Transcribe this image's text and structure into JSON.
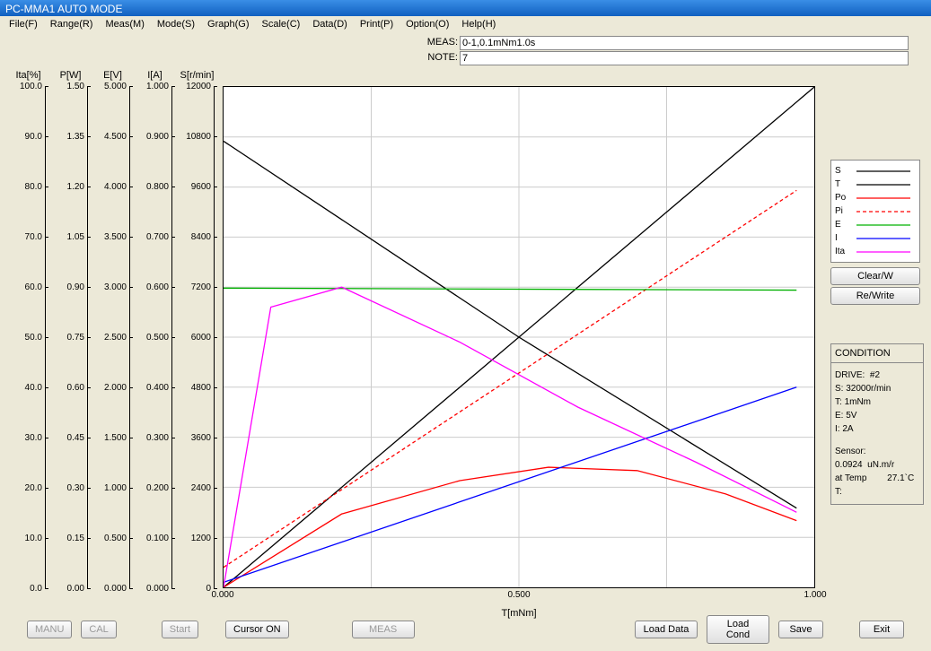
{
  "title": "PC-MMA1 AUTO MODE",
  "menu": {
    "file": "File(F)",
    "range": "Range(R)",
    "meas": "Meas(M)",
    "mode": "Mode(S)",
    "graph": "Graph(G)",
    "scale": "Scale(C)",
    "data": "Data(D)",
    "print": "Print(P)",
    "option": "Option(O)",
    "help": "Help(H)"
  },
  "meas_label": "MEAS:",
  "meas_value": "0-1,0.1mNm1.0s",
  "note_label": "NOTE:",
  "note_value": "7",
  "yaxes": [
    {
      "title": "Ita[%]",
      "ticks": [
        "100.0",
        "90.0",
        "80.0",
        "70.0",
        "60.0",
        "50.0",
        "40.0",
        "30.0",
        "20.0",
        "10.0",
        "0.0"
      ]
    },
    {
      "title": "P[W]",
      "ticks": [
        "1.50",
        "1.35",
        "1.20",
        "1.05",
        "0.90",
        "0.75",
        "0.60",
        "0.45",
        "0.30",
        "0.15",
        "0.00"
      ]
    },
    {
      "title": "E[V]",
      "ticks": [
        "5.000",
        "4.500",
        "4.000",
        "3.500",
        "3.000",
        "2.500",
        "2.000",
        "1.500",
        "1.000",
        "0.500",
        "0.000"
      ]
    },
    {
      "title": "I[A]",
      "ticks": [
        "1.000",
        "0.900",
        "0.800",
        "0.700",
        "0.600",
        "0.500",
        "0.400",
        "0.300",
        "0.200",
        "0.100",
        "0.000"
      ]
    },
    {
      "title": "S[r/min]",
      "ticks": [
        "12000",
        "10800",
        "9600",
        "8400",
        "7200",
        "6000",
        "4800",
        "3600",
        "2400",
        "1200",
        "0"
      ]
    }
  ],
  "xaxis": {
    "label": "T[mNm]",
    "ticks": [
      "0.000",
      "0.500",
      "1.000"
    ]
  },
  "legend": [
    {
      "name": "S",
      "color": "#000000",
      "dash": ""
    },
    {
      "name": "T",
      "color": "#000000",
      "dash": ""
    },
    {
      "name": "Po",
      "color": "#ff0000",
      "dash": ""
    },
    {
      "name": "Pi",
      "color": "#ff0000",
      "dash": "4 3"
    },
    {
      "name": "E",
      "color": "#00b000",
      "dash": ""
    },
    {
      "name": "I",
      "color": "#0000ff",
      "dash": ""
    },
    {
      "name": "Ita",
      "color": "#ff00ff",
      "dash": ""
    }
  ],
  "side_buttons": {
    "clear": "Clear/W",
    "rewrite": "Re/Write"
  },
  "condition": {
    "title": "CONDITION",
    "drive_lbl": "DRIVE:",
    "drive_val": "#2",
    "s_lbl": "S:",
    "s_val": "32000r/min",
    "t_lbl": "T:",
    "t_val": "1mNm",
    "e_lbl": "E:",
    "e_val": "5V",
    "i_lbl": "I:",
    "i_val": "2A",
    "sensor_lbl": "Sensor:",
    "sensor_val": "0.0924",
    "sensor_unit": "uN.m/r",
    "temp_lbl": "at Temp",
    "temp_val": "27.1`C",
    "t2_lbl": "T:"
  },
  "bottom": {
    "manu": "MANU",
    "cal": "CAL",
    "start": "Start",
    "cursor": "Cursor ON",
    "meas": "MEAS",
    "load_data": "Load Data",
    "load_cond": "Load Cond",
    "save": "Save",
    "exit": "Exit"
  },
  "chart_data": {
    "type": "line",
    "xlabel": "T[mNm]",
    "xlim": [
      0,
      1
    ],
    "series": [
      {
        "name": "S",
        "ylabel": "S[r/min]",
        "ylim": [
          0,
          12000
        ],
        "x": [
          0,
          0.5,
          0.97
        ],
        "y": [
          10700,
          6000,
          1900
        ]
      },
      {
        "name": "T",
        "ylabel": "T[mNm]",
        "ylim": [
          0,
          1
        ],
        "x": [
          0,
          1
        ],
        "y": [
          0,
          1
        ]
      },
      {
        "name": "Po",
        "ylabel": "P[W]",
        "ylim": [
          0,
          1.5
        ],
        "x": [
          0,
          0.2,
          0.4,
          0.55,
          0.7,
          0.85,
          0.97
        ],
        "y": [
          0,
          0.22,
          0.32,
          0.36,
          0.35,
          0.28,
          0.2
        ]
      },
      {
        "name": "Pi",
        "ylabel": "P[W]",
        "ylim": [
          0,
          1.5
        ],
        "x": [
          0,
          0.97
        ],
        "y": [
          0.06,
          1.19
        ]
      },
      {
        "name": "E",
        "ylabel": "E[V]",
        "ylim": [
          0,
          5
        ],
        "x": [
          0,
          0.97
        ],
        "y": [
          2.99,
          2.97
        ]
      },
      {
        "name": "I",
        "ylabel": "I[A]",
        "ylim": [
          0,
          1
        ],
        "x": [
          0,
          0.97
        ],
        "y": [
          0.01,
          0.4
        ]
      },
      {
        "name": "Ita",
        "ylabel": "Ita[%]",
        "ylim": [
          0,
          100
        ],
        "x": [
          0,
          0.08,
          0.2,
          0.4,
          0.6,
          0.8,
          0.97
        ],
        "y": [
          0,
          56,
          60,
          49,
          36,
          25,
          15
        ]
      }
    ]
  }
}
